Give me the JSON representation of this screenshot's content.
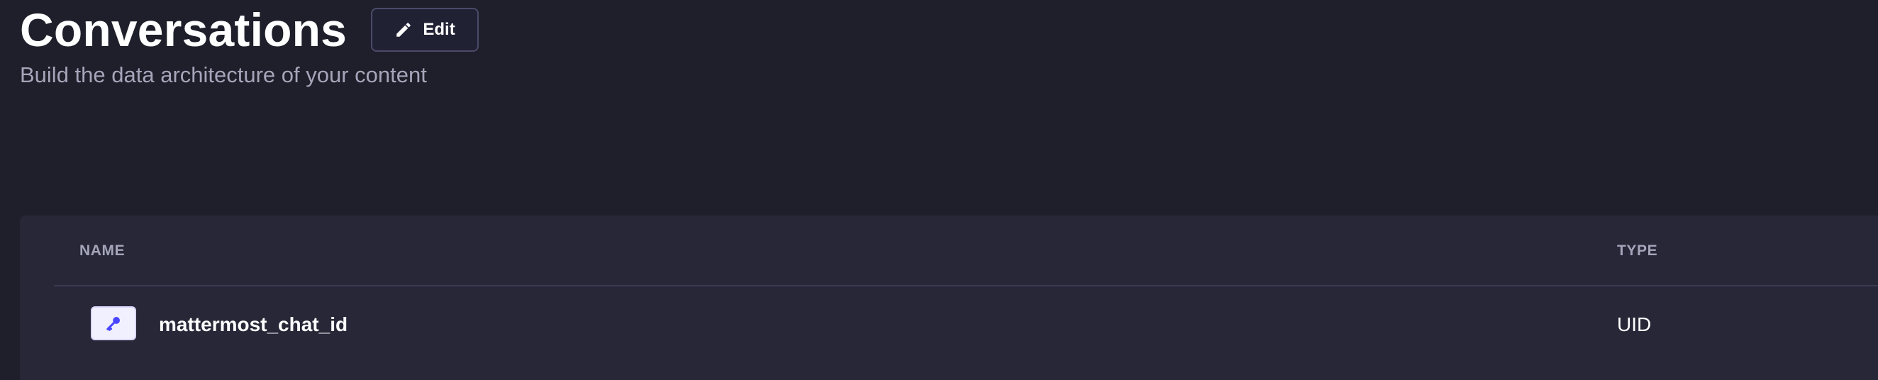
{
  "header": {
    "title": "Conversations",
    "edit_label": "Edit",
    "subtitle": "Build the data architecture of your content"
  },
  "table": {
    "columns": [
      "NAME",
      "TYPE"
    ],
    "rows": [
      {
        "name": "mattermost_chat_id",
        "type": "UID",
        "icon": "key-icon"
      }
    ]
  },
  "colors": {
    "background": "#1f1f2b",
    "card": "#272738",
    "accent": "#4945ff",
    "muted_text": "#a5a5ba"
  }
}
